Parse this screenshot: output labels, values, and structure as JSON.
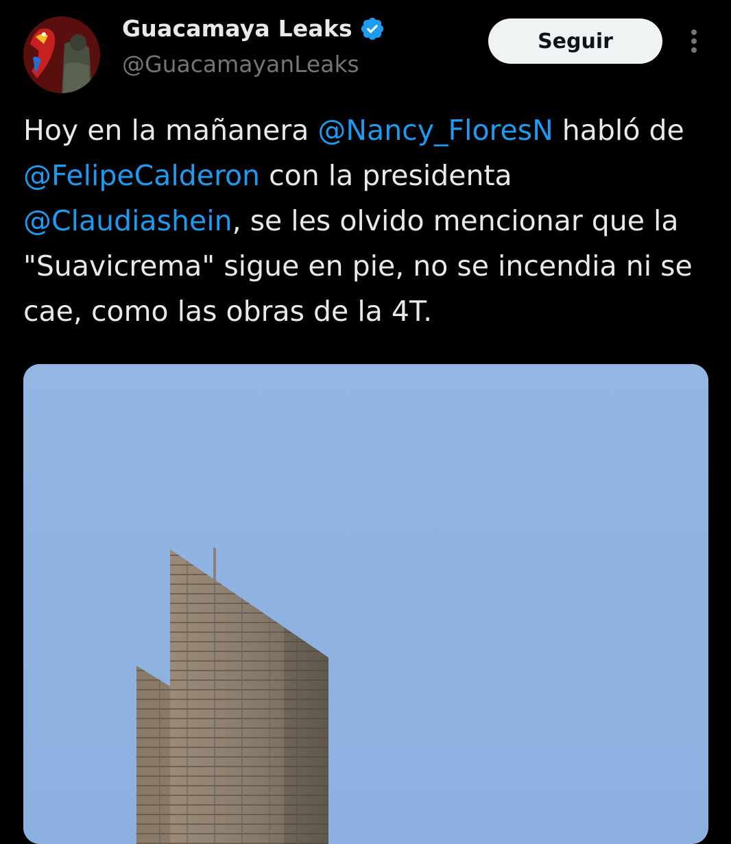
{
  "author": {
    "display_name": "Guacamaya Leaks",
    "handle": "@GuacamayanLeaks",
    "verified_icon": "verified-badge",
    "avatar_icon": "avatar"
  },
  "follow_button": {
    "label": "Seguir"
  },
  "more_icon": "more-vertical-icon",
  "tweet": {
    "segments": [
      {
        "text": "Hoy en la mañanera ",
        "type": "text"
      },
      {
        "text": "@Nancy_FloresN",
        "type": "mention"
      },
      {
        "text": " habló de ",
        "type": "text"
      },
      {
        "text": "@FelipeCalderon",
        "type": "mention"
      },
      {
        "text": " con la presidenta ",
        "type": "text"
      },
      {
        "text": "@Claudiashein",
        "type": "mention"
      },
      {
        "text": ", se les olvido mencionar que la \"Suavicrema\" sigue en pie, no se incendia ni se cae, como las obras de la 4T.",
        "type": "text"
      }
    ]
  },
  "colors": {
    "background": "#000000",
    "text": "#e7e9ea",
    "secondary_text": "#71767b",
    "link": "#1d9bf0",
    "verified": "#1d9bf0",
    "sky": "#8fb3e0"
  }
}
